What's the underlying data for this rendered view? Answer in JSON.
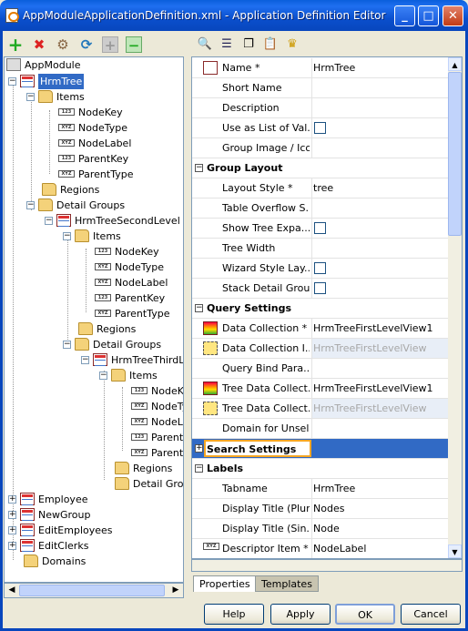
{
  "window": {
    "title": "AppModuleApplicationDefinition.xml - Application Definition Editor",
    "minimize": "_",
    "maximize": "□",
    "close": "✕"
  },
  "left_toolbar": {
    "add": "+",
    "delete": "✖",
    "tool3": "⚙",
    "refresh": "⟳",
    "expand": "+",
    "collapse": "−"
  },
  "tree": {
    "nodes": [
      {
        "label": "AppModule",
        "icon": "app-icon",
        "expanded": true
      },
      {
        "label": "HrmTree",
        "icon": "view-icon",
        "selected": true
      },
      {
        "label": "Items",
        "icon": "folder-icon"
      },
      {
        "label": "NodeKey",
        "icon": "attribute-icon"
      },
      {
        "label": "NodeType",
        "icon": "attribute-icon"
      },
      {
        "label": "NodeLabel",
        "icon": "attribute-icon"
      },
      {
        "label": "ParentKey",
        "icon": "attribute-icon"
      },
      {
        "label": "ParentType",
        "icon": "attribute-icon"
      },
      {
        "label": "Regions",
        "icon": "folder-icon"
      },
      {
        "label": "Detail Groups",
        "icon": "folder-icon"
      },
      {
        "label": "HrmTreeSecondLevel",
        "icon": "view-icon"
      },
      {
        "label": "Items",
        "icon": "folder-icon"
      },
      {
        "label": "NodeKey",
        "icon": "attribute-icon"
      },
      {
        "label": "NodeType",
        "icon": "attribute-icon"
      },
      {
        "label": "NodeLabel",
        "icon": "attribute-icon"
      },
      {
        "label": "ParentKey",
        "icon": "attribute-icon"
      },
      {
        "label": "ParentType",
        "icon": "attribute-icon"
      },
      {
        "label": "Regions",
        "icon": "folder-icon"
      },
      {
        "label": "Detail Groups",
        "icon": "folder-icon"
      },
      {
        "label": "HrmTreeThirdLe",
        "icon": "view-icon"
      },
      {
        "label": "Items",
        "icon": "folder-icon"
      },
      {
        "label": "NodeKe",
        "icon": "attribute-icon"
      },
      {
        "label": "NodeTy",
        "icon": "attribute-icon"
      },
      {
        "label": "NodeLa",
        "icon": "attribute-icon"
      },
      {
        "label": "Parent",
        "icon": "attribute-icon"
      },
      {
        "label": "ParentT",
        "icon": "attribute-icon"
      },
      {
        "label": "Regions",
        "icon": "folder-icon"
      },
      {
        "label": "Detail Group",
        "icon": "folder-icon"
      },
      {
        "label": "Employee",
        "icon": "view-icon"
      },
      {
        "label": "NewGroup",
        "icon": "view-icon"
      },
      {
        "label": "EditEmployees",
        "icon": "view-icon"
      },
      {
        "label": "EditClerks",
        "icon": "view-icon"
      },
      {
        "label": "Domains",
        "icon": "folder-icon"
      }
    ],
    "attr_icon_text": "XYZ",
    "attr_icon_num": "123"
  },
  "right_toolbar": {
    "binoculars": "🔍",
    "list": "☰",
    "copy": "❐",
    "paste": "📋",
    "crown": "♛"
  },
  "properties": {
    "name_label": "Name *",
    "name_value": "HrmTree",
    "short_name": "Short Name",
    "description": "Description",
    "use_as_list": "Use as List of Val...",
    "group_image": "Group Image / Icon",
    "group_layout": "Group Layout",
    "layout_style": "Layout Style *",
    "layout_style_value": "tree",
    "table_overflow": "Table Overflow S...",
    "show_tree": "Show Tree Expa...",
    "tree_width": "Tree Width",
    "wizard_style": "Wizard Style Lay...",
    "stack_detail": "Stack Detail Grou...",
    "query_settings": "Query Settings",
    "data_collection": "Data Collection *",
    "data_collection_value": "HrmTreeFirstLevelView1",
    "data_collection_i": "Data Collection I...",
    "data_collection_i_value": "HrmTreeFirstLevelView",
    "query_bind": "Query Bind Para...",
    "tree_data_1": "Tree Data Collect...",
    "tree_data_1_value": "HrmTreeFirstLevelView1",
    "tree_data_2": "Tree Data Collect...",
    "tree_data_2_value": "HrmTreeFirstLevelView",
    "domain_unsel": "Domain for Unsel...",
    "search_settings": "Search Settings",
    "labels": "Labels",
    "tabname": "Tabname",
    "tabname_value": "HrmTree",
    "display_plural": "Display Title (Plur...",
    "display_plural_value": "Nodes",
    "display_single": "Display Title (Sin...",
    "display_single_value": "Node",
    "descriptor_item": "Descriptor Item *",
    "descriptor_item_value": "NodeLabel"
  },
  "tabs": {
    "properties": "Properties",
    "templates": "Templates"
  },
  "buttons": {
    "help": "Help",
    "apply": "Apply",
    "ok": "OK",
    "cancel": "Cancel"
  },
  "colors": {
    "title_bar": "#0a5fdc",
    "selection": "#316ac5",
    "search_outline": "#f5a623",
    "disabled_text": "#a7a7a7"
  }
}
